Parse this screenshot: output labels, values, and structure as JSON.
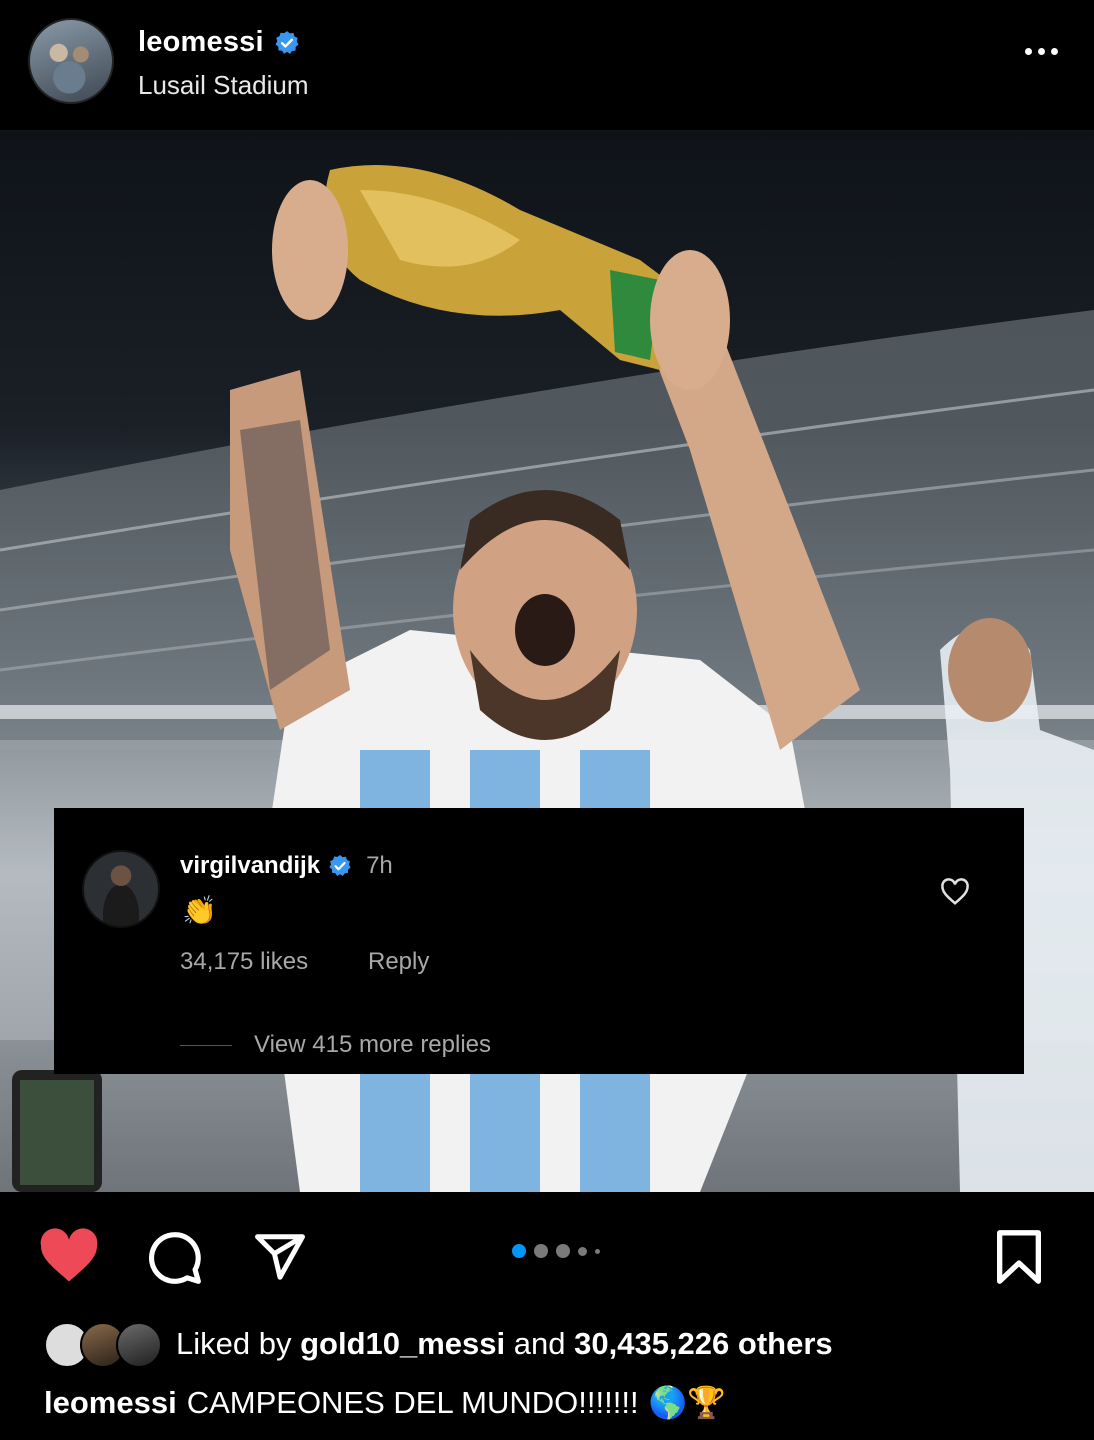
{
  "post": {
    "username": "leomessi",
    "location": "Lusail Stadium",
    "verified": true
  },
  "comment": {
    "username": "virgilvandijk",
    "time": "7h",
    "text": "👏",
    "likes": "34,175 likes",
    "reply_label": "Reply",
    "view_replies": "View 415 more replies"
  },
  "actions": {
    "liked": true,
    "like_color": "#ed4956",
    "carousel_count": 5,
    "carousel_active": 0,
    "accent": "#0095f6"
  },
  "likes": {
    "prefix": "Liked by",
    "user": "gold10_messi",
    "middle": "and",
    "count": "30,435,226 others"
  },
  "caption": {
    "username": "leomessi",
    "text": "CAMPEONES DEL MUNDO!!!!!!!",
    "emojis": "🌎🏆"
  }
}
